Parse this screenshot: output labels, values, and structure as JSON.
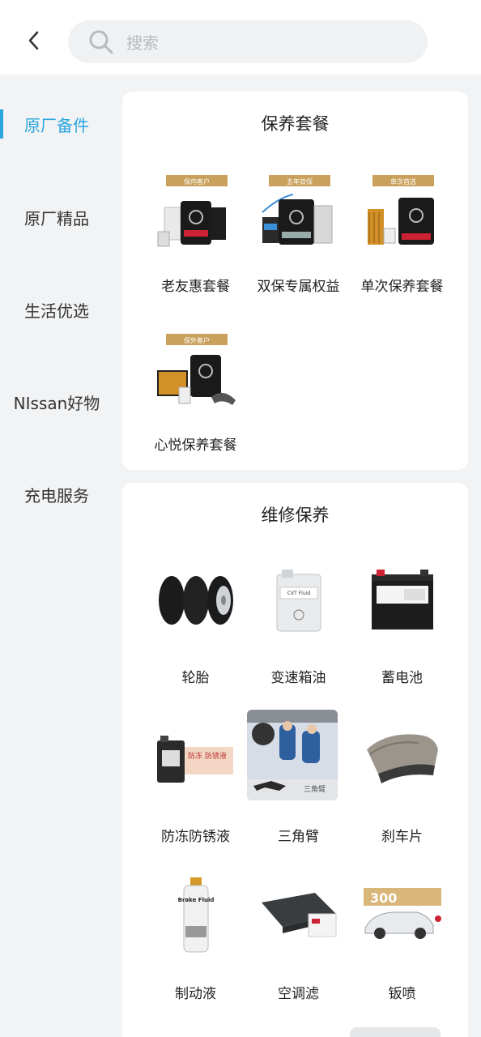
{
  "header": {
    "search_placeholder": "搜索"
  },
  "sidebar": {
    "items": [
      {
        "label": "原厂备件",
        "active": true
      },
      {
        "label": "原厂精品",
        "active": false
      },
      {
        "label": "生活优选",
        "active": false
      },
      {
        "label": "NIssan好物",
        "active": false
      },
      {
        "label": "充电服务",
        "active": false
      }
    ]
  },
  "sections": [
    {
      "title": "保养套餐",
      "items": [
        {
          "label": "老友惠套餐",
          "tag": "保内客户",
          "icon": "oil-package-image"
        },
        {
          "label": "双保专属权益",
          "tag": "五年双保",
          "icon": "oil-package-image"
        },
        {
          "label": "单次保养套餐",
          "tag": "单次首选",
          "icon": "oil-filter-package-image"
        },
        {
          "label": "心悦保养套餐",
          "tag": "保外客户",
          "icon": "oil-brake-package-image"
        }
      ]
    },
    {
      "title": "维修保养",
      "items": [
        {
          "label": "轮胎",
          "icon": "tires-image"
        },
        {
          "label": "变速箱油",
          "icon": "transmission-oil-image",
          "product_text": "CVT Fluid"
        },
        {
          "label": "蓄电池",
          "icon": "battery-image"
        },
        {
          "label": "防冻防锈液",
          "icon": "coolant-image",
          "product_text": "防冻\n防锈液"
        },
        {
          "label": "三角臂",
          "icon": "control-arm-image",
          "product_text": "三角臂"
        },
        {
          "label": "刹车片",
          "icon": "brake-pads-image"
        },
        {
          "label": "制动液",
          "icon": "brake-fluid-image",
          "product_text": "Brake Fluid"
        },
        {
          "label": "空调滤",
          "icon": "cabin-filter-image"
        },
        {
          "label": "钣喷",
          "icon": "paint-service-image",
          "product_text": "300"
        }
      ]
    }
  ],
  "colors": {
    "accent": "#2aa6e0",
    "tag_gold": "#c9a15c",
    "background": "#f2f3f5"
  }
}
